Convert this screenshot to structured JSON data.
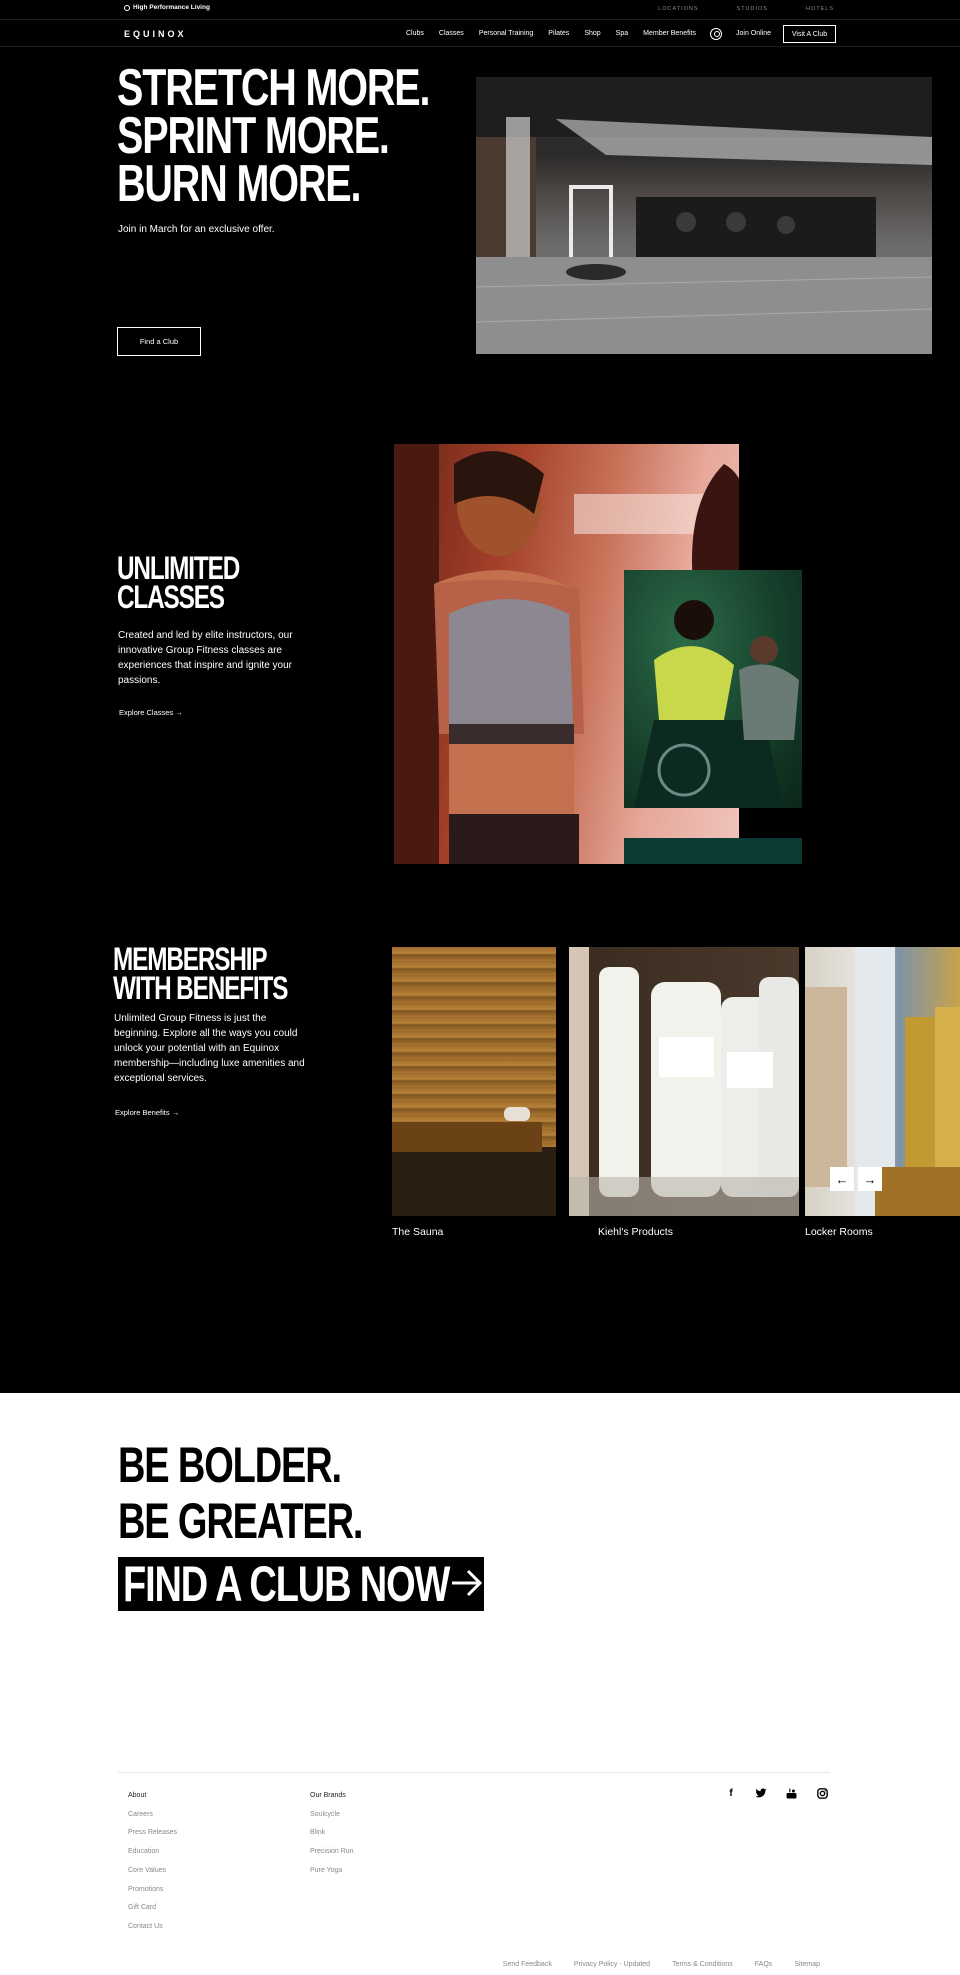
{
  "utility_bar": {
    "tagline": "High Performance Living",
    "links": [
      "LOCATIONS",
      "STUDIOS",
      "HOTELS"
    ]
  },
  "nav": {
    "logo": "EQUINOX",
    "menu": [
      "Clubs",
      "Classes",
      "Personal Training",
      "Pilates",
      "Shop",
      "Spa",
      "Member Benefits"
    ],
    "join_online": "Join Online",
    "visit_club": "Visit A Club"
  },
  "hero": {
    "headline": [
      "STRETCH MORE.",
      "SPRINT MORE.",
      "BURN MORE."
    ],
    "subtext": "Join in March for an exclusive offer.",
    "button": "Find a Club"
  },
  "classes": {
    "headline": [
      "UNLIMITED",
      "CLASSES"
    ],
    "body": "Created and led by elite instructors, our innovative Group Fitness classes are experiences that inspire and ignite your passions.",
    "link": "Explore Classes →"
  },
  "benefits": {
    "headline": [
      "MEMBERSHIP",
      "WITH BENEFITS"
    ],
    "body": "Unlimited Group Fitness is just the beginning. Explore all the ways you could unlock your potential with an Equinox membership—including luxe amenities and exceptional services.",
    "link": "Explore Benefits →",
    "cards": [
      "The Sauna",
      "Kiehl's Products",
      "Locker Rooms"
    ],
    "arrow_prev": "←",
    "arrow_next": "→"
  },
  "cta": {
    "lines": [
      "BE BOLDER.",
      "BE GREATER."
    ],
    "box_text": "FIND A CLUB NOW"
  },
  "footer": {
    "col1": {
      "title": "About",
      "items": [
        "Careers",
        "Press Releases",
        "Education",
        "Core Values",
        "Promotions",
        "Gift Card",
        "Contact Us"
      ]
    },
    "col2": {
      "title": "Our Brands",
      "items": [
        "Soulcycle",
        "Blink",
        "Precision Run",
        "Pure Yoga"
      ]
    },
    "social_icons": [
      "facebook-icon",
      "twitter-icon",
      "youtube-icon",
      "instagram-icon"
    ],
    "bottom_links": [
      "Send Feedback",
      "Privacy Policy - Updated",
      "Terms & Conditions",
      "FAQs",
      "Sitemap"
    ]
  }
}
